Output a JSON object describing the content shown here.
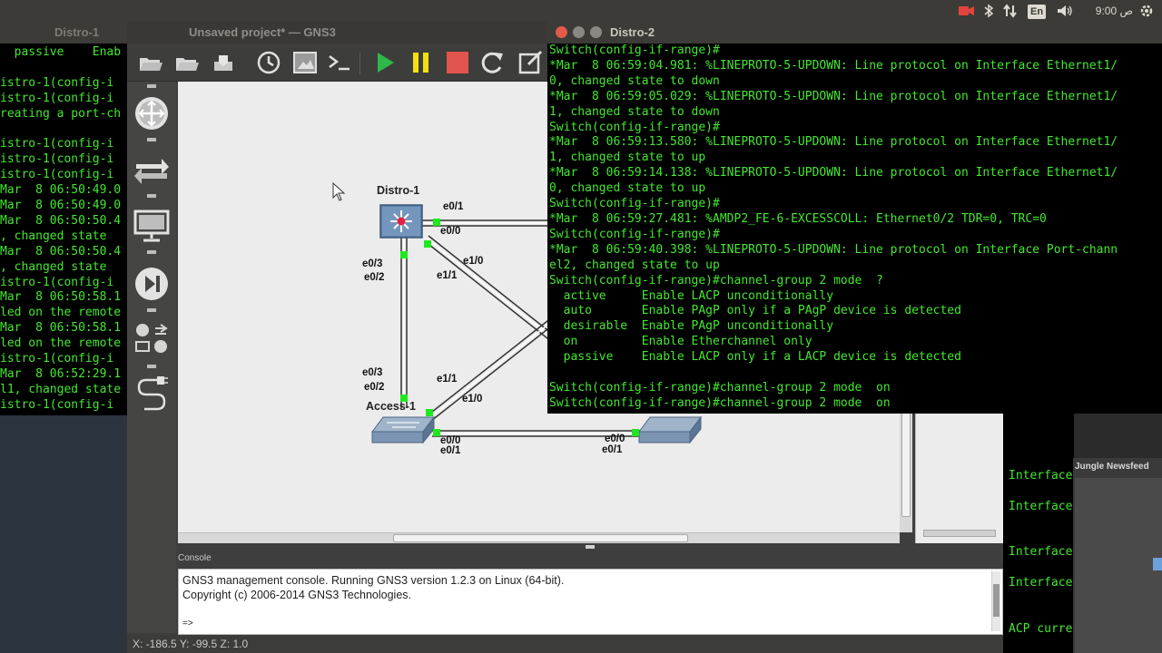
{
  "top_panel": {
    "language": "En",
    "clock": "9:00 ص",
    "colors": {
      "bg": "#3c3b37",
      "text": "#dfdbd2",
      "recording": "#e3433f"
    },
    "icons": [
      "camera-recording-icon",
      "bluetooth-icon",
      "network-icon",
      "keyboard-layout-icon",
      "volume-icon",
      "power-gear-icon"
    ]
  },
  "distro1_terminal": {
    "title": "Distro-1",
    "lines": [
      "  passive    Enab",
      "",
      "istro-1(config-i",
      "istro-1(config-i",
      "reating a port-ch",
      "",
      "istro-1(config-i",
      "istro-1(config-i",
      "istro-1(config-i",
      "Mar  8 06:50:49.0",
      "Mar  8 06:50:49.0",
      "Mar  8 06:50:50.4",
      ", changed state",
      "Mar  8 06:50:50.4",
      ", changed state",
      "istro-1(config-i",
      "Mar  8 06:50:58.1",
      "led on the remote",
      "Mar  8 06:50:58.1",
      "led on the remote",
      "istro-1(config-i",
      "Mar  8 06:52:29.1",
      "l1, changed state",
      "istro-1(config-i"
    ]
  },
  "distro2_terminal": {
    "title": "Distro-2",
    "lines": [
      "Switch(config-if-range)#",
      "*Mar  8 06:59:04.981: %LINEPROTO-5-UPDOWN: Line protocol on Interface Ethernet1/",
      "0, changed state to down",
      "*Mar  8 06:59:05.029: %LINEPROTO-5-UPDOWN: Line protocol on Interface Ethernet1/",
      "1, changed state to down",
      "Switch(config-if-range)#",
      "*Mar  8 06:59:13.580: %LINEPROTO-5-UPDOWN: Line protocol on Interface Ethernet1/",
      "1, changed state to up",
      "*Mar  8 06:59:14.138: %LINEPROTO-5-UPDOWN: Line protocol on Interface Ethernet1/",
      "0, changed state to up",
      "Switch(config-if-range)#",
      "*Mar  8 06:59:27.481: %AMDP2_FE-6-EXCESSCOLL: Ethernet0/2 TDR=0, TRC=0",
      "Switch(config-if-range)#",
      "*Mar  8 06:59:40.398: %LINEPROTO-5-UPDOWN: Line protocol on Interface Port-chann",
      "el2, changed state to up",
      "Switch(config-if-range)#channel-group 2 mode  ?",
      "  active     Enable LACP unconditionally",
      "  auto       Enable PAgP only if a PAgP device is detected",
      "  desirable  Enable PAgP unconditionally",
      "  on         Enable Etherchannel only",
      "  passive    Enable LACP only if a LACP device is detected",
      "",
      "Switch(config-if-range)#channel-group 2 mode  on",
      "Switch(config-if-range)#channel-group 2 mode  on"
    ]
  },
  "bg_terminal": {
    "lines": [
      "Interface",
      "",
      "Interface",
      "",
      "",
      "Interface",
      "",
      "Interface",
      "",
      "",
      "ACP curren"
    ]
  },
  "gns3": {
    "title": "Unsaved project* — GNS3",
    "toolbar_icons": [
      "open-folder-icon",
      "open-project-icon",
      "save-icon",
      "history-icon",
      "screenshot-icon",
      "console-icon",
      "start-icon",
      "pause-icon",
      "stop-icon",
      "reload-icon",
      "edit-icon"
    ],
    "device_icons": [
      "router-icon",
      "switch-icon",
      "end-device-icon",
      "security-device-icon",
      "all-devices-icon",
      "add-link-icon"
    ],
    "nodes": {
      "distro1": "Distro-1",
      "access1": "Access-1"
    },
    "ports": {
      "d1_e01": "e0/1",
      "d1_e00": "e0/0",
      "d1_e03": "e0/3",
      "d1_e02": "e0/2",
      "d1_e10": "e1/0",
      "d1_e11": "e1/1",
      "a1_e03": "e0/3",
      "a1_e02": "e0/2",
      "a1_e11": "e1/1",
      "a1_e10": "e1/0",
      "a1_e00": "e0/0",
      "a1_e01": "e0/1",
      "a2_e00": "e0/0",
      "a2_e01": "e0/1"
    },
    "console": {
      "title": "Console",
      "lines": [
        "GNS3 management console. Running GNS3 version 1.2.3 on Linux (64-bit).",
        "Copyright (c) 2006-2014 GNS3 Technologies.",
        "",
        "=>"
      ]
    },
    "status": "X: -186.5 Y: -99.5 Z: 1.0",
    "colors": {
      "canvas": "#ececec",
      "link_up": "#1ee81e",
      "node_blue": "#5d7fa6",
      "play": "#2fb84a",
      "pause": "#f1e10e",
      "stop": "#e1534d"
    }
  },
  "newsfeed": {
    "title": "Jungle Newsfeed"
  }
}
